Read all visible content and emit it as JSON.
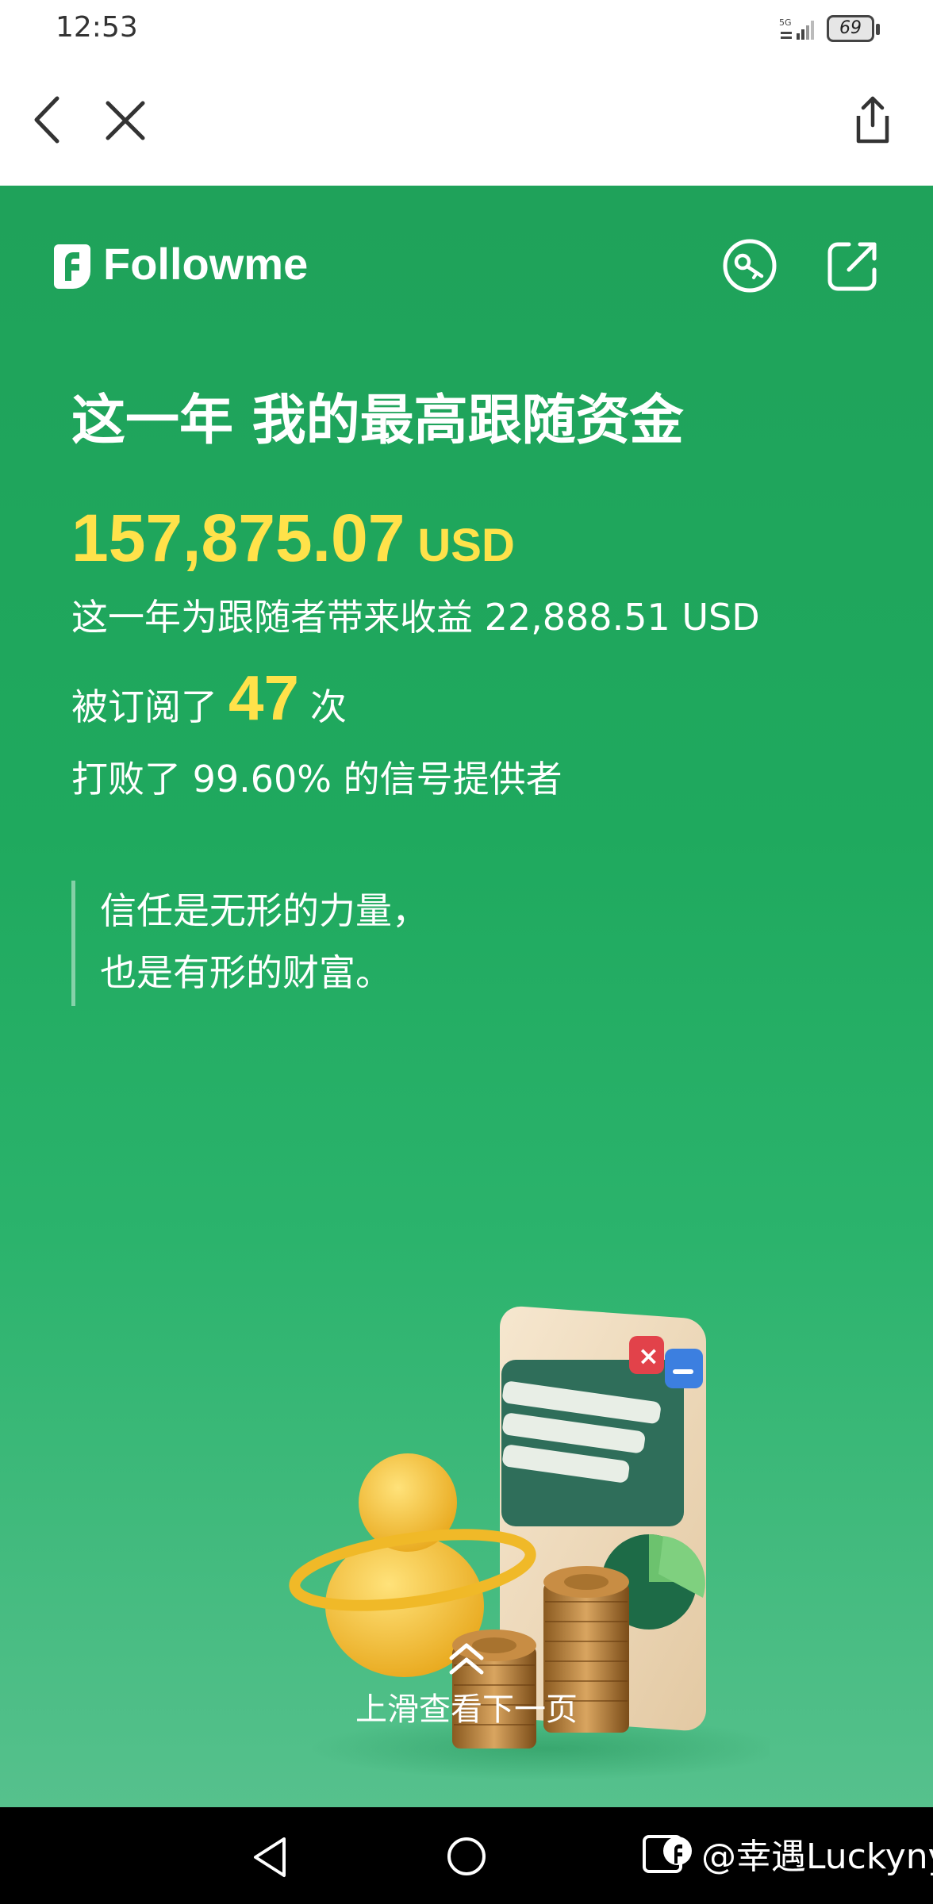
{
  "status_bar": {
    "time": "12:53",
    "network": "5G",
    "battery": "69"
  },
  "nav": {
    "back_icon": "chevron-left-icon",
    "close_icon": "close-icon",
    "share_icon": "share-icon"
  },
  "brand": {
    "name": "Followme",
    "logo_icon": "followme-logo",
    "actions": [
      "key-icon",
      "external-link-icon"
    ]
  },
  "report": {
    "headline": "这一年 我的最高跟随资金",
    "amount": "157,875.07",
    "amount_unit": "USD",
    "earn_line": "这一年为跟随者带来收益 22,888.51 USD",
    "subscribed_prefix": "被订阅了",
    "subscribed_count": "47",
    "subscribed_suffix": "次",
    "beat_line": "打败了 99.60% 的信号提供者",
    "quote_line_1": "信任是无形的力量，",
    "quote_line_2": "也是有形的财富。"
  },
  "footer": {
    "swipe_hint": "上滑查看下一页"
  },
  "watermark": {
    "text": "@幸遇Luckyny"
  },
  "colors": {
    "green": "#1fa25a",
    "highlight": "#ffe24a"
  }
}
